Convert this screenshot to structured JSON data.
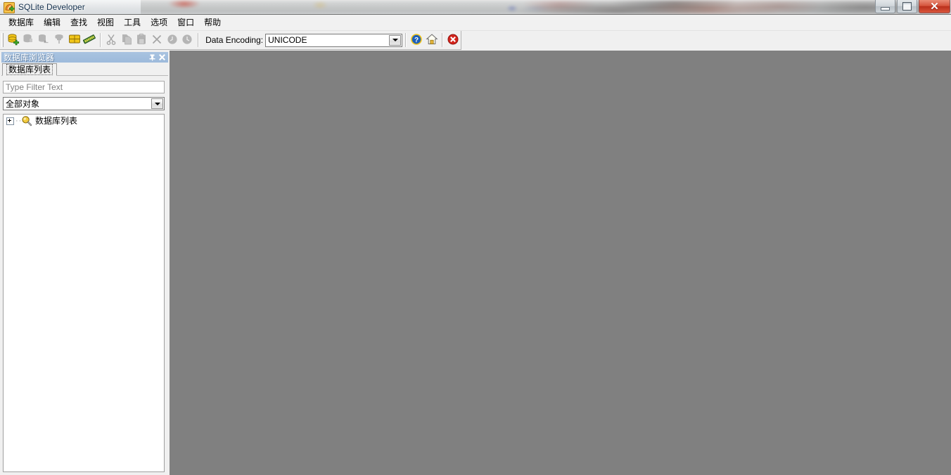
{
  "window": {
    "title": "SQLite Developer",
    "app_icon": "sqlite-app-icon",
    "controls": {
      "minimize_label": "Minimize",
      "maximize_label": "Restore",
      "close_label": "✕"
    }
  },
  "menubar": {
    "items": [
      {
        "label": "数据库",
        "name": "menu-database"
      },
      {
        "label": "编辑",
        "name": "menu-edit"
      },
      {
        "label": "查找",
        "name": "menu-find"
      },
      {
        "label": "视图",
        "name": "menu-view"
      },
      {
        "label": "工具",
        "name": "menu-tools"
      },
      {
        "label": "选项",
        "name": "menu-options"
      },
      {
        "label": "窗口",
        "name": "menu-window"
      },
      {
        "label": "帮助",
        "name": "menu-help"
      }
    ]
  },
  "toolbar": {
    "buttons": [
      {
        "name": "new-database-button",
        "icon": "database-add-icon",
        "enabled": true
      },
      {
        "name": "open-database-button",
        "icon": "database-open-icon",
        "enabled": false
      },
      {
        "name": "close-database-button",
        "icon": "database-close-icon",
        "enabled": false
      },
      {
        "name": "attach-database-button",
        "icon": "database-attach-icon",
        "enabled": false
      },
      {
        "name": "table-button",
        "icon": "table-icon",
        "enabled": true
      },
      {
        "name": "memory-button",
        "icon": "memory-chip-icon",
        "enabled": true
      },
      {
        "name": "cut-button",
        "icon": "scissors-icon",
        "enabled": false
      },
      {
        "name": "copy-button",
        "icon": "copy-icon",
        "enabled": false
      },
      {
        "name": "paste-button",
        "icon": "paste-icon",
        "enabled": false
      },
      {
        "name": "delete-button",
        "icon": "close-x-icon",
        "enabled": false
      },
      {
        "name": "undo-button",
        "icon": "undo-clock-icon",
        "enabled": false
      },
      {
        "name": "redo-button",
        "icon": "redo-clock-icon",
        "enabled": false
      }
    ],
    "encoding_label": "Data Encoding:",
    "encoding_value": "UNICODE",
    "encoding_options": [
      "UNICODE"
    ],
    "help_button": {
      "name": "help-button",
      "icon": "help-question-icon"
    },
    "home_button": {
      "name": "home-button",
      "icon": "home-icon"
    },
    "stop_button": {
      "name": "stop-button",
      "icon": "error-stop-icon"
    }
  },
  "sidebar": {
    "panel_title": "数据库浏览器",
    "pin_icon": "pin-icon",
    "close_icon": "close-icon",
    "tabs": [
      {
        "label": "数据库列表",
        "name": "tab-database-list",
        "active": true
      }
    ],
    "filter_placeholder": "Type Filter Text",
    "filter_value": "",
    "object_filter_value": "全部对象",
    "object_filter_options": [
      "全部对象"
    ],
    "tree": [
      {
        "label": "数据库列表",
        "icon": "database-search-icon",
        "expanded": false,
        "name": "tree-node-database-list"
      }
    ]
  },
  "colors": {
    "window_chrome": "#f0f0f0",
    "client_area": "#808080",
    "panel_header": "#a3bedd",
    "accent_blue": "#9dbadb",
    "title_text": "#16324f",
    "close_button": "#c33a22"
  }
}
